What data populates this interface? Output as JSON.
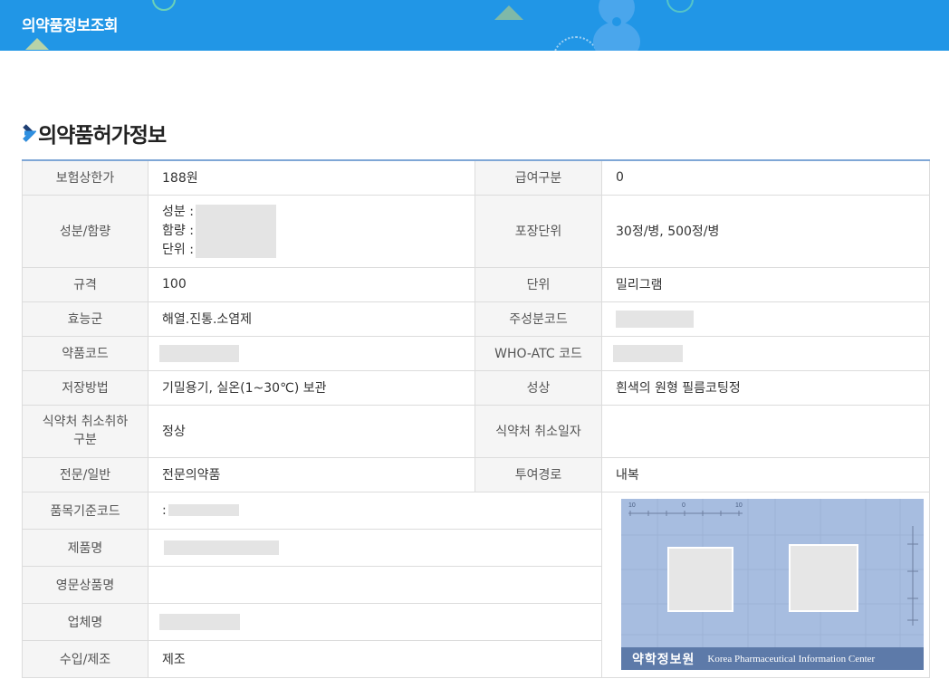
{
  "header": {
    "title": "의약품정보조회",
    "background_color": "#2196e6"
  },
  "section": {
    "title": "의약품허가정보",
    "icon": "chevron-right-icon"
  },
  "table": {
    "insurance_price": {
      "label": "보험상한가",
      "value": "188원"
    },
    "benefit_class": {
      "label": "급여구분",
      "value": "0"
    },
    "ingredients": {
      "label": "성분/함량",
      "ingredient_label": "성분 :",
      "amount_label": "함량 :",
      "unit_label": "단위 :"
    },
    "package_unit": {
      "label": "포장단위",
      "value": "30정/병, 500정/병"
    },
    "spec": {
      "label": "규격",
      "value": "100"
    },
    "unit": {
      "label": "단위",
      "value": "밀리그램"
    },
    "efficacy_group": {
      "label": "효능군",
      "value": "해열.진통.소염제"
    },
    "main_ingredient_code": {
      "label": "주성분코드",
      "value": ""
    },
    "drug_code": {
      "label": "약품코드",
      "value": ""
    },
    "who_atc_code": {
      "label": "WHO-ATC 코드",
      "value": ""
    },
    "storage": {
      "label": "저장방법",
      "value": "기밀용기, 실온(1~30℃) 보관"
    },
    "appearance": {
      "label": "성상",
      "value": "흰색의 원형 필름코팅정"
    },
    "mfds_cancel_type": {
      "label": "식약처 취소취하 구분",
      "value": "정상"
    },
    "mfds_cancel_date": {
      "label": "식약처 취소일자",
      "value": ""
    },
    "prescription_type": {
      "label": "전문/일반",
      "value": "전문의약품"
    },
    "route": {
      "label": "투여경로",
      "value": "내복"
    },
    "item_standard_code": {
      "label": "품목기준코드",
      "value": ":"
    },
    "product_name": {
      "label": "제품명",
      "value": ""
    },
    "english_name": {
      "label": "영문상품명",
      "value": ""
    },
    "company": {
      "label": "업체명",
      "value": ""
    },
    "import_manufacture": {
      "label": "수입/제조",
      "value": "제조"
    }
  },
  "pill_image": {
    "footer_korean": "약학정보원",
    "footer_english": "Korea Pharmaceutical Information Center",
    "ruler_numbers": [
      "10",
      "0",
      "10"
    ],
    "background_color": "#a7bde0"
  }
}
